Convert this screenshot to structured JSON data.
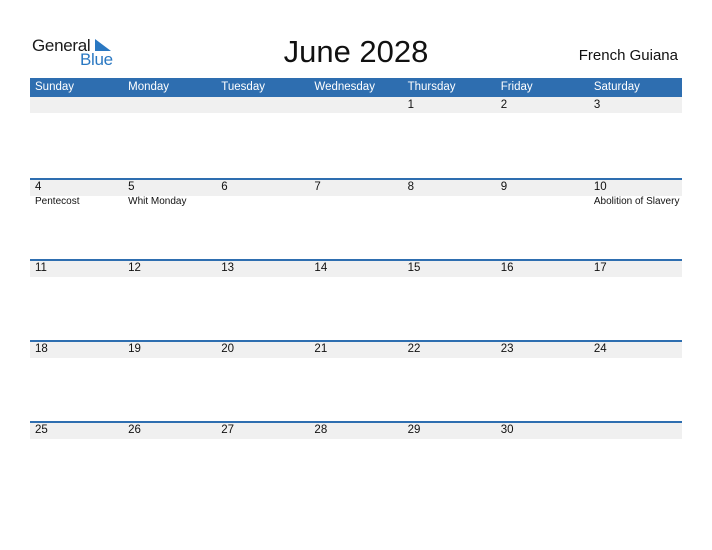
{
  "logo": {
    "part1": "General",
    "part2": "Blue"
  },
  "title": "June 2028",
  "country": "French Guiana",
  "weekdays": [
    "Sunday",
    "Monday",
    "Tuesday",
    "Wednesday",
    "Thursday",
    "Friday",
    "Saturday"
  ],
  "weeks": [
    {
      "days": [
        {
          "num": "",
          "holiday": ""
        },
        {
          "num": "",
          "holiday": ""
        },
        {
          "num": "",
          "holiday": ""
        },
        {
          "num": "",
          "holiday": ""
        },
        {
          "num": "1",
          "holiday": ""
        },
        {
          "num": "2",
          "holiday": ""
        },
        {
          "num": "3",
          "holiday": ""
        }
      ]
    },
    {
      "days": [
        {
          "num": "4",
          "holiday": "Pentecost"
        },
        {
          "num": "5",
          "holiday": "Whit Monday"
        },
        {
          "num": "6",
          "holiday": ""
        },
        {
          "num": "7",
          "holiday": ""
        },
        {
          "num": "8",
          "holiday": ""
        },
        {
          "num": "9",
          "holiday": ""
        },
        {
          "num": "10",
          "holiday": "Abolition of Slavery"
        }
      ]
    },
    {
      "days": [
        {
          "num": "11",
          "holiday": ""
        },
        {
          "num": "12",
          "holiday": ""
        },
        {
          "num": "13",
          "holiday": ""
        },
        {
          "num": "14",
          "holiday": ""
        },
        {
          "num": "15",
          "holiday": ""
        },
        {
          "num": "16",
          "holiday": ""
        },
        {
          "num": "17",
          "holiday": ""
        }
      ]
    },
    {
      "days": [
        {
          "num": "18",
          "holiday": ""
        },
        {
          "num": "19",
          "holiday": ""
        },
        {
          "num": "20",
          "holiday": ""
        },
        {
          "num": "21",
          "holiday": ""
        },
        {
          "num": "22",
          "holiday": ""
        },
        {
          "num": "23",
          "holiday": ""
        },
        {
          "num": "24",
          "holiday": ""
        }
      ]
    },
    {
      "days": [
        {
          "num": "25",
          "holiday": ""
        },
        {
          "num": "26",
          "holiday": ""
        },
        {
          "num": "27",
          "holiday": ""
        },
        {
          "num": "28",
          "holiday": ""
        },
        {
          "num": "29",
          "holiday": ""
        },
        {
          "num": "30",
          "holiday": ""
        },
        {
          "num": "",
          "holiday": ""
        }
      ]
    }
  ],
  "colors": {
    "header_bg": "#2e6eb0",
    "brand_blue": "#2a78c2",
    "band_bg": "#f0f0f0"
  }
}
